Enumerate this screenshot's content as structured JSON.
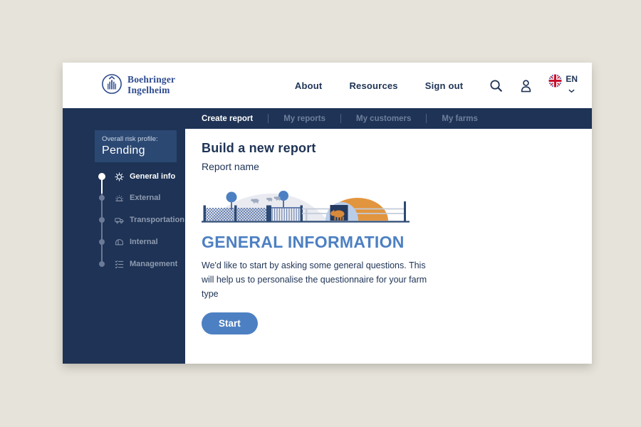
{
  "header": {
    "logo": {
      "line1": "Boehringer",
      "line2": "Ingelheim"
    },
    "nav": [
      {
        "label": "About"
      },
      {
        "label": "Resources"
      },
      {
        "label": "Sign out"
      }
    ],
    "language": {
      "code": "EN"
    }
  },
  "navbar": {
    "items": [
      {
        "label": "Create report",
        "active": true
      },
      {
        "label": "My reports",
        "active": false
      },
      {
        "label": "My customers",
        "active": false
      },
      {
        "label": "My farms",
        "active": false
      }
    ]
  },
  "sidebar": {
    "risk": {
      "label": "Overall risk profile:",
      "value": "Pending"
    },
    "steps": [
      {
        "label": "General info",
        "icon": "gear-icon",
        "active": true
      },
      {
        "label": "External",
        "icon": "farm-signal-icon",
        "active": false
      },
      {
        "label": "Transportation",
        "icon": "truck-icon",
        "active": false
      },
      {
        "label": "Internal",
        "icon": "barn-icon",
        "active": false
      },
      {
        "label": "Management",
        "icon": "checklist-icon",
        "active": false
      }
    ]
  },
  "main": {
    "title": "Build a new report",
    "subtitle": "Report name",
    "section_heading": "GENERAL INFORMATION",
    "description": "We'd like to start by asking some general questions. This will help us to personalise the questionnaire for your farm type",
    "start_button": "Start"
  },
  "colors": {
    "navy": "#1e3355",
    "logo_blue": "#2d4b8f",
    "accent_blue": "#4d80c2",
    "orange": "#e2953f",
    "muted_text": "#8e9ab0",
    "page_background": "#e6e3da",
    "risk_box": "#2b4873"
  }
}
